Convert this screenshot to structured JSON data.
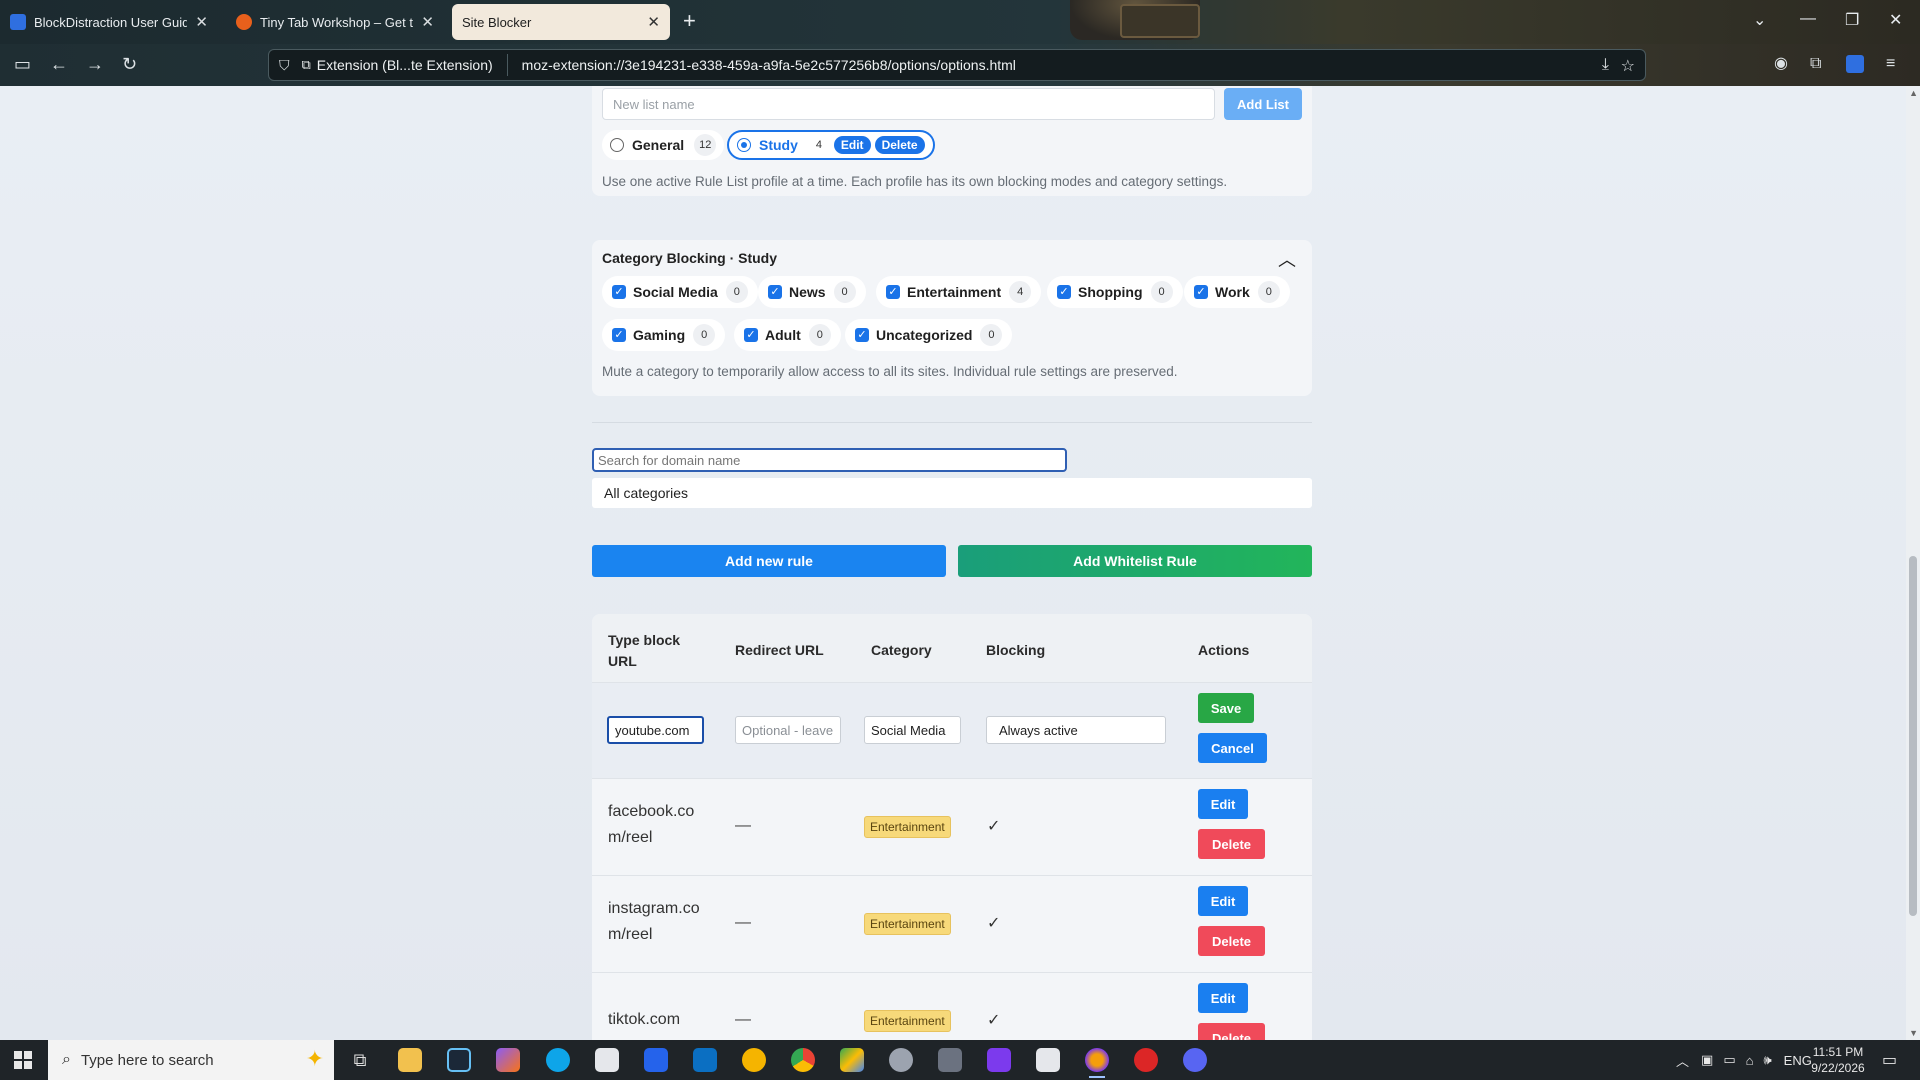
{
  "browser": {
    "tabs": [
      {
        "title": "BlockDistraction User Guide: Ru",
        "favicon_color": "#2f6fe0"
      },
      {
        "title": "Tiny Tab Workshop – Get this Th",
        "favicon_color": "#e8601c"
      },
      {
        "title": "Site Blocker",
        "favicon_color": "#f2e9dc"
      }
    ],
    "extension_label": "Extension (Bl...te Extension)",
    "url": "moz-extension://3e194231-e338-459a-a9fa-5e2c577256b8/options/options.html"
  },
  "profiles": {
    "new_list_placeholder": "New list name",
    "add_list_label": "Add List",
    "items": [
      {
        "name": "General",
        "count": "12"
      },
      {
        "name": "Study",
        "count": "4",
        "edit_label": "Edit",
        "delete_label": "Delete"
      }
    ],
    "hint": "Use one active Rule List profile at a time. Each profile has its own blocking modes and category settings."
  },
  "category_blocking": {
    "title": "Category Blocking · Study",
    "chips": [
      {
        "label": "Social Media",
        "count": "0"
      },
      {
        "label": "News",
        "count": "0"
      },
      {
        "label": "Entertainment",
        "count": "4"
      },
      {
        "label": "Shopping",
        "count": "0"
      },
      {
        "label": "Work",
        "count": "0"
      },
      {
        "label": "Gaming",
        "count": "0"
      },
      {
        "label": "Adult",
        "count": "0"
      },
      {
        "label": "Uncategorized",
        "count": "0"
      }
    ],
    "hint": "Mute a category to temporarily allow access to all its sites. Individual rule settings are preserved."
  },
  "filters": {
    "search_placeholder": "Search for domain name",
    "category_value": "All categories"
  },
  "actions": {
    "add_rule_label": "Add new rule",
    "add_whitelist_label": "Add Whitelist Rule"
  },
  "table": {
    "headers": [
      "Type block URL",
      "Redirect URL",
      "Category",
      "Blocking",
      "Actions"
    ],
    "edit_row": {
      "url_value": "youtube.com",
      "redirect_placeholder": "Optional - leave",
      "category_value": "Social Media",
      "blocking_value": "Always active",
      "save_label": "Save",
      "cancel_label": "Cancel"
    },
    "rows": [
      {
        "domain": "facebook.com/reel",
        "redirect": "—",
        "category": "Entertainment",
        "blocking": "✓",
        "edit_label": "Edit",
        "delete_label": "Delete"
      },
      {
        "domain": "instagram.com/reel",
        "redirect": "—",
        "category": "Entertainment",
        "blocking": "✓",
        "edit_label": "Edit",
        "delete_label": "Delete"
      },
      {
        "domain": "tiktok.com",
        "redirect": "—",
        "category": "Entertainment",
        "blocking": "✓",
        "edit_label": "Edit",
        "delete_label": "Delete"
      }
    ]
  },
  "taskbar": {
    "search_placeholder": "Type here to search",
    "language": "ENG",
    "time": "11:51 PM",
    "date": "9/22/2026"
  }
}
